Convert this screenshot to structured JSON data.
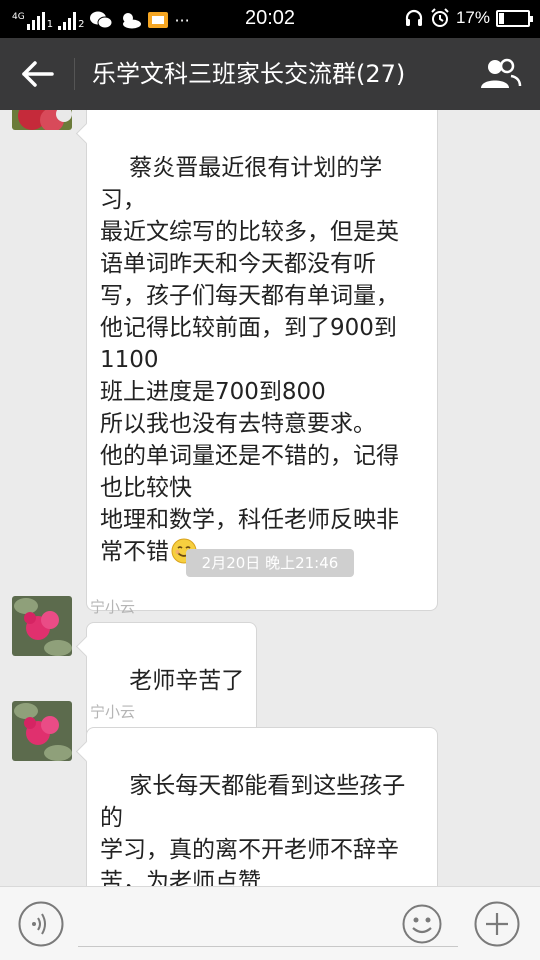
{
  "status_bar": {
    "network_label": "4G",
    "sim1": "1",
    "sim2": "2",
    "more": "···",
    "time": "20:02",
    "battery": "17%",
    "battery_level": 0.17,
    "icons": [
      "signal-icon",
      "wechat-icon",
      "weather-icon",
      "app-icon",
      "headset-icon",
      "alarm-icon",
      "battery-icon"
    ]
  },
  "header": {
    "title": "乐学文科三班家长交流群(27)",
    "icons": [
      "back-arrow-icon",
      "group-members-icon"
    ]
  },
  "messages": [
    {
      "sender": "",
      "text": "蔡炎晋最近很有计划的学习，\n最近文综写的比较多，但是英\n语单词昨天和今天都没有听\n写，孩子们每天都有单词量，\n他记得比较前面，到了900到\n1100\n班上进度是700到800\n所以我也没有去特意要求。\n他的单词量还是不错的，记得\n也比较快\n地理和数学，科任老师反映非\n常不错",
      "emoji": "smile-emoji-icon"
    },
    {
      "sender": "宁小云",
      "text": "老师辛苦了"
    },
    {
      "sender": "宁小云",
      "text": "家长每天都能看到这些孩子的\n学习，真的离不开老师不辞辛\n苦，为老师点赞"
    }
  ],
  "timestamp": "2月20日  晚上21:46",
  "input_bar": {
    "value": "",
    "icons": [
      "voice-icon",
      "emoji-icon",
      "plus-icon"
    ]
  },
  "colors": {
    "header_bg": "#39393a",
    "chat_bg": "#ebebeb",
    "bubble_bg": "#ffffff"
  }
}
